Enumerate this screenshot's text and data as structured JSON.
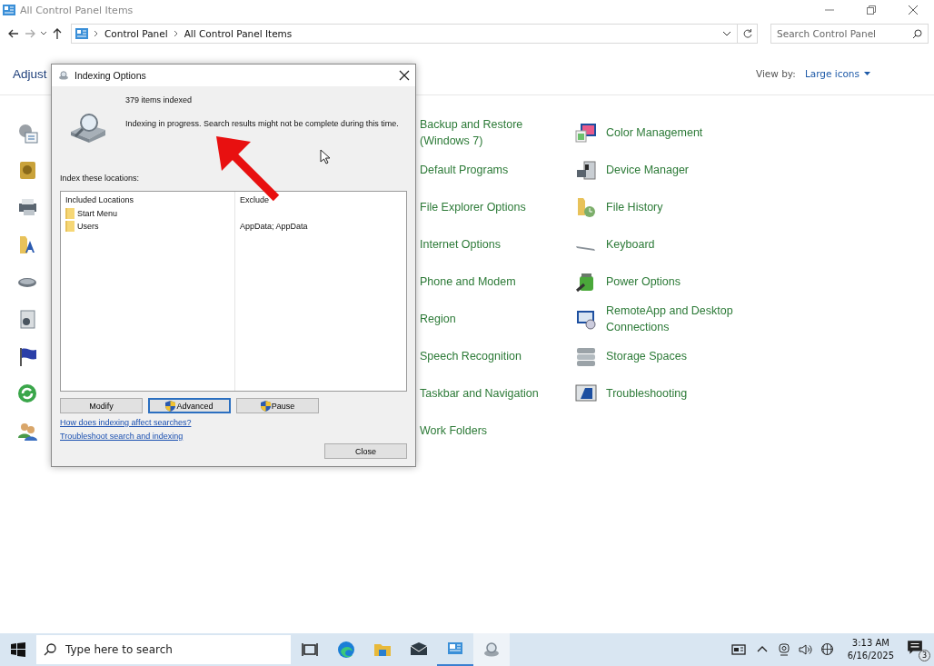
{
  "window": {
    "title": "All Control Panel Items",
    "breadcrumb": [
      "Control Panel",
      "All Control Panel Items"
    ],
    "search_placeholder": "Search Control Panel"
  },
  "header": {
    "heading": "Adjust",
    "view_by_label": "View by:",
    "view_by_value": "Large icons"
  },
  "column_3": [
    {
      "label": "Backup and Restore (Windows 7)"
    },
    {
      "label": "Default Programs"
    },
    {
      "label": "File Explorer Options"
    },
    {
      "label": "Internet Options"
    },
    {
      "label": "Phone and Modem"
    },
    {
      "label": "Region"
    },
    {
      "label": "Speech Recognition"
    },
    {
      "label": "Taskbar and Navigation"
    },
    {
      "label": "Work Folders"
    }
  ],
  "column_4": [
    {
      "label": "Color Management"
    },
    {
      "label": "Device Manager"
    },
    {
      "label": "File History"
    },
    {
      "label": "Keyboard"
    },
    {
      "label": "Power Options"
    },
    {
      "label": "RemoteApp and Desktop Connections"
    },
    {
      "label": "Storage Spaces"
    },
    {
      "label": "Troubleshooting"
    }
  ],
  "dialog": {
    "title": "Indexing Options",
    "count": "379 items indexed",
    "status": "Indexing in progress. Search results might not be complete during this time.",
    "locations_label": "Index these locations:",
    "columns": [
      "Included Locations",
      "Exclude"
    ],
    "rows": [
      {
        "location": "Start Menu"
      },
      {
        "location": "Users",
        "exclude": "AppData; AppData"
      }
    ],
    "buttons": [
      {
        "label": "Modify",
        "shield": false,
        "focused": false
      },
      {
        "label": "Advanced",
        "shield": true,
        "focused": true
      },
      {
        "label": "Pause",
        "shield": true,
        "focused": false
      }
    ],
    "links": [
      "How does indexing affect searches?",
      "Troubleshoot search and indexing"
    ],
    "close_button": "Close"
  },
  "taskbar": {
    "search_placeholder": "Type here to search",
    "apps": [
      {
        "open": false,
        "active": false
      },
      {
        "open": false,
        "active": false
      },
      {
        "open": false,
        "active": false
      },
      {
        "open": false,
        "active": false
      },
      {
        "open": true,
        "active": false
      },
      {
        "open": false,
        "active": true
      }
    ],
    "time": "3:13 AM",
    "date": "6/16/2025",
    "notifications": "3"
  }
}
